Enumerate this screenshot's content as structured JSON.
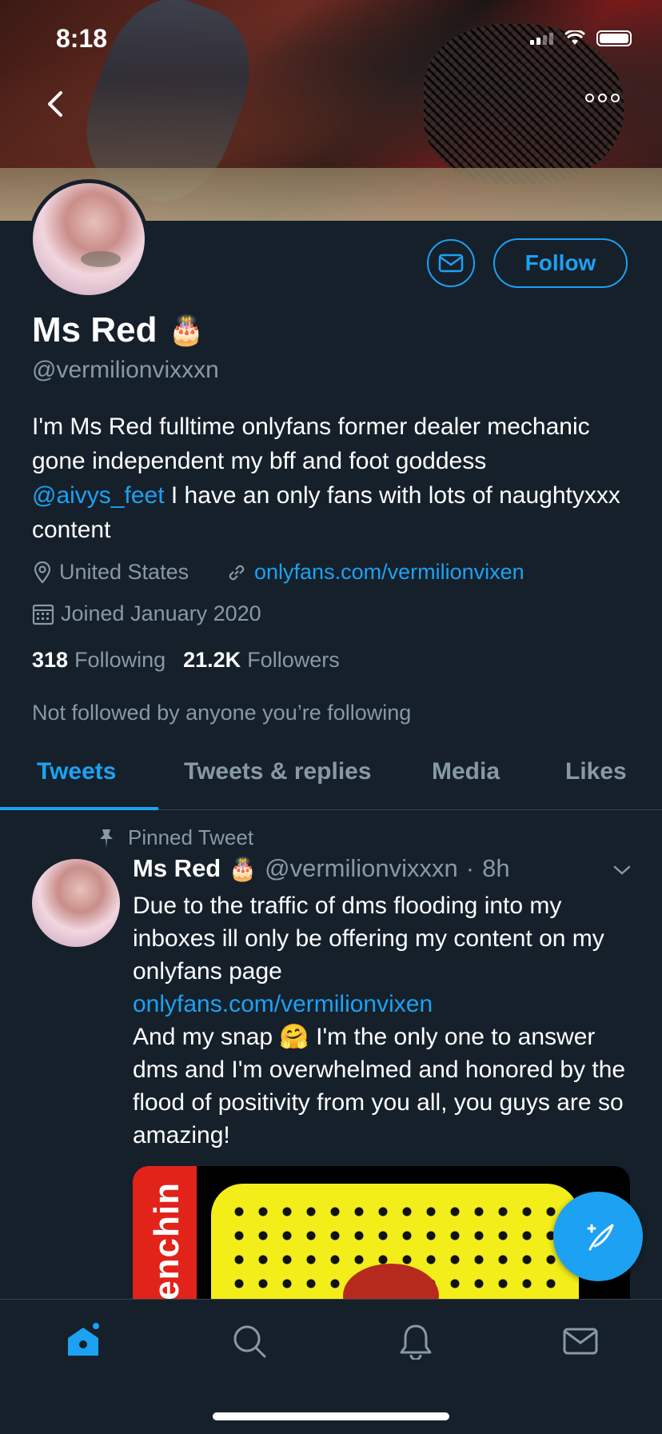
{
  "status_bar": {
    "time": "8:18"
  },
  "profile": {
    "name": "Ms Red",
    "name_emoji": "🎂",
    "handle": "@vermilionvixxxn",
    "bio_part1": "I'm Ms Red fulltime onlyfans former dealer mechanic gone independent my bff and foot goddess ",
    "bio_mention": "@aivys_feet",
    "bio_part2": " I have an only fans with lots of naughtyxxx content",
    "location": "United States",
    "website": "onlyfans.com/vermilionvixen",
    "joined": "Joined January 2020",
    "following_count": "318",
    "following_label": "Following",
    "followers_count": "21.2K",
    "followers_label": "Followers",
    "not_followed": "Not followed by anyone you’re following",
    "follow_label": "Follow"
  },
  "tabs": [
    {
      "label": "Tweets",
      "active": true
    },
    {
      "label": "Tweets & replies",
      "active": false
    },
    {
      "label": "Media",
      "active": false
    },
    {
      "label": "Likes",
      "active": false
    }
  ],
  "pinned_tweet": {
    "pinned_label": "Pinned Tweet",
    "name": "Ms Red",
    "name_emoji": "🎂",
    "handle": "@vermilionvixxxn",
    "separator": "·",
    "time": "8h",
    "line1": "Due to the traffic of dms flooding into my inboxes ill only be offering my content on my onlyfans page",
    "link": "onlyfans.com/vermilionvixen",
    "line2": "And my snap 🤗 I'm the only one to answer dms and I'm overwhelmed and honored by the flood of positivity from you all, you guys are so amazing!",
    "media_sidebar_text": "enchin"
  },
  "colors": {
    "accent": "#1da1f2",
    "background": "#15202b",
    "secondary_text": "#8899a6"
  },
  "icons": [
    "back-icon",
    "more-icon",
    "mail-icon",
    "location-icon",
    "link-icon",
    "calendar-icon",
    "pin-icon",
    "chevron-down-icon",
    "compose-icon",
    "home-icon",
    "search-icon",
    "bell-icon"
  ]
}
